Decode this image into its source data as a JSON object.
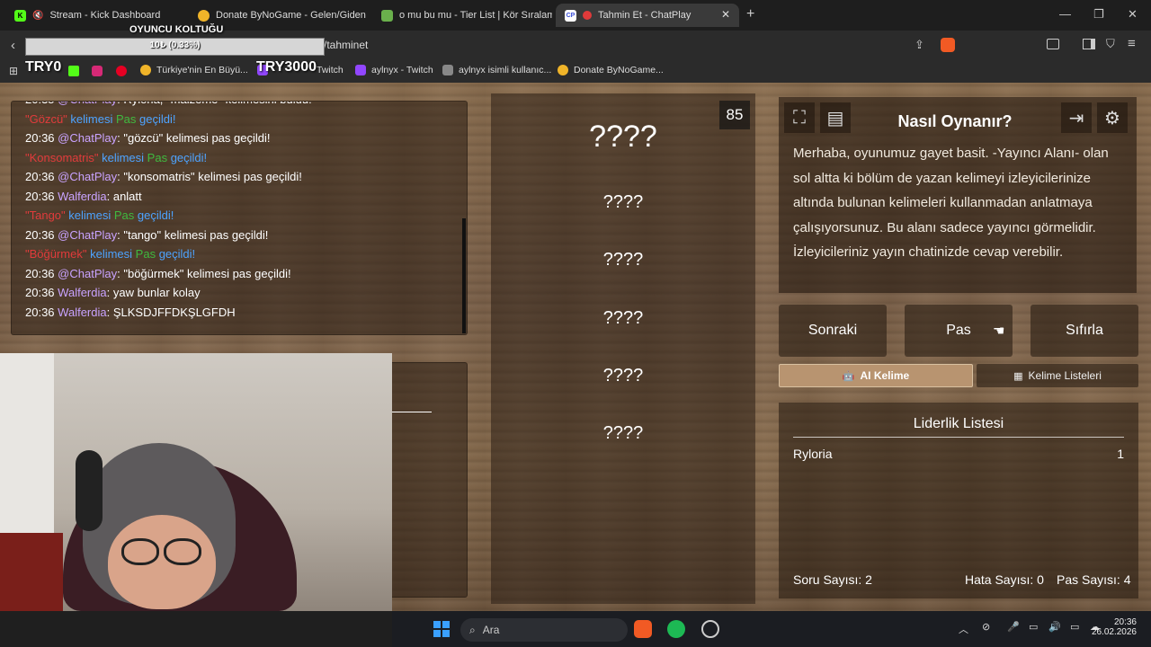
{
  "tabs": [
    {
      "title": "Stream - Kick Dashboard",
      "icon": "kick-icon"
    },
    {
      "title": "Donate ByNoGame - Gelen/Giden Ba",
      "icon": "bynogame-icon"
    },
    {
      "title": "o mu bu mu - Tier List | Kör Sıralama",
      "icon": "tierlist-icon"
    },
    {
      "title": "Tahmin Et - ChatPlay",
      "icon": "chatplay-icon"
    }
  ],
  "address": {
    "url": "/tahminet"
  },
  "bookmarks": [
    "Türkiye'nin En Büyü...",
    "Twitch",
    "aylnyx - Twitch",
    "aylnyx isimli kullanıc...",
    "Donate ByNoGame..."
  ],
  "overlay": {
    "seat_title": "OYUNCU KOLTUĞU",
    "seat_progress_text": "10₺ (0.33%)",
    "seat_progress_value": 0.33,
    "left_amount": "TRY0",
    "right_amount": "TRY3000"
  },
  "chat": {
    "messages": [
      {
        "time": "20:35",
        "user": "@ChatPlay",
        "text": ": Ryloria, \"malzeme\" kelimesini buldu!",
        "user_color": "#c9a3ff"
      },
      {
        "time": "",
        "user": "\"Gözcü\"",
        "text": " kelimesi Pas geçildi!",
        "user_color": "#e13b3b"
      },
      {
        "time": "20:36",
        "user": "@ChatPlay",
        "text": ": \"gözcü\" kelimesi pas geçildi!",
        "user_color": "#c9a3ff"
      },
      {
        "time": "",
        "user": "\"Konsomatris\"",
        "text": " kelimesi Pas geçildi!",
        "user_color": "#e13b3b"
      },
      {
        "time": "20:36",
        "user": "@ChatPlay",
        "text": ": \"konsomatris\" kelimesi pas geçildi!",
        "user_color": "#c9a3ff"
      },
      {
        "time": "20:36",
        "user": "Walferdia",
        "text": ": anlatt",
        "user_color": "#c9a3ff"
      },
      {
        "time": "",
        "user": "\"Tango\"",
        "text": " kelimesi Pas geçildi!",
        "user_color": "#e13b3b"
      },
      {
        "time": "20:36",
        "user": "@ChatPlay",
        "text": ": \"tango\" kelimesi pas geçildi!",
        "user_color": "#c9a3ff"
      },
      {
        "time": "",
        "user": "\"Böğürmek\"",
        "text": " kelimesi Pas geçildi!",
        "user_color": "#e13b3b"
      },
      {
        "time": "20:36",
        "user": "@ChatPlay",
        "text": ": \"böğürmek\" kelimesi pas geçildi!",
        "user_color": "#c9a3ff"
      },
      {
        "time": "20:36",
        "user": "Walferdia",
        "text": ": yaw bunlar kolay",
        "user_color": "#c9a3ff"
      },
      {
        "time": "20:36",
        "user": "Walferdia",
        "text": ": ŞLKSDJFFDKŞLGFDH",
        "user_color": "#c9a3ff"
      }
    ],
    "pas_color": "#3fb93f",
    "kelimesi_color": "#4da3ff"
  },
  "game": {
    "timer": "85",
    "main_word": "????",
    "forbidden_words": [
      "????",
      "????",
      "????",
      "????",
      "????"
    ]
  },
  "howto": {
    "title": "Nasıl Oynanır?",
    "body": "Merhaba, oyunumuz gayet basit. -Yayıncı Alanı- olan sol altta ki bölüm de yazan kelimeyi izleyicilerinize altında bulunan kelimeleri kullanmadan anlatmaya çalışıyorsunuz. Bu alanı sadece yayıncı görmelidir. İzleyicileriniz yayın chatinizde cevap verebilir."
  },
  "controls": {
    "next": "Sonraki",
    "pass": "Pas",
    "reset": "Sıfırla",
    "ai_words": "AI Kelime",
    "word_lists": "Kelime Listeleri"
  },
  "leaderboard": {
    "title": "Liderlik Listesi",
    "rows": [
      {
        "name": "Ryloria",
        "score": "1"
      }
    ],
    "questions": "Soru Sayısı: 2",
    "errors": "Hata Sayısı: 0",
    "passes": "Pas Sayısı: 4"
  },
  "taskbar": {
    "search_placeholder": "Ara",
    "time": "20:36",
    "date": "26.02.2026"
  }
}
